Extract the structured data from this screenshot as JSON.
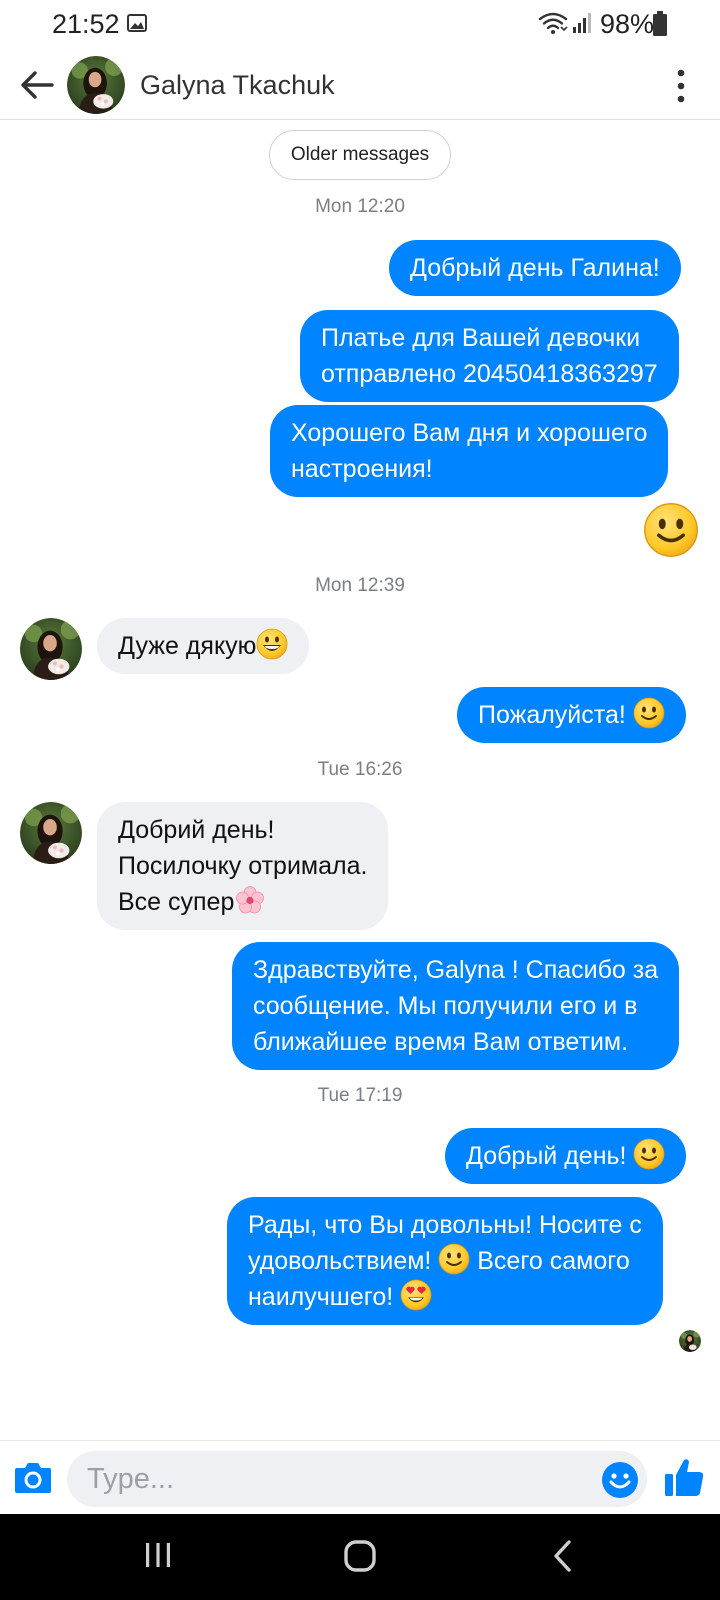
{
  "status_bar": {
    "time": "21:52",
    "battery": "98%"
  },
  "header": {
    "contact_name": "Galyna Tkachuk"
  },
  "older_messages_label": "Older messages",
  "thread": {
    "ts1": "Mon 12:20",
    "m1": "Добрый день Галина!",
    "m2_line1": "Платье для Вашей девочки",
    "m2_line2": "отправлено 20450418363297",
    "m3_line1": "Хорошего Вам дня  и хорошего",
    "m3_line2": "настроения!",
    "ts2": "Mon 12:39",
    "m4": "Дуже дякую",
    "m5": "Пожалуйста! ",
    "ts3": "Tue 16:26",
    "m6_line1": "Добрий день!",
    "m6_line2": "Посилочку отримала.",
    "m6_line3": "Все супер",
    "m7_line1": "Здравствуйте, Galyna ! Спасибо за",
    "m7_line2": "сообщение. Мы получили его и в",
    "m7_line3": "ближайшее время  Вам ответим.",
    "ts4": "Tue 17:19",
    "m8": "Добрый день! ",
    "m9_line1": "Рады, что Вы довольны!  Носите с",
    "m9_line2a": "удовольствием! ",
    "m9_line2b": "  Всего самого",
    "m9_line3": "наилучшего! "
  },
  "composer": {
    "placeholder": "Type..."
  },
  "icons": {
    "back": "back-arrow-icon",
    "more": "more-vertical-icon",
    "camera": "camera-icon",
    "emoji": "emoji-icon",
    "like": "thumbs-up-icon"
  },
  "colors": {
    "accent": "#0084ff",
    "incoming_bubble": "#eef0f3",
    "emoji_yellow": "#ffcc33"
  }
}
